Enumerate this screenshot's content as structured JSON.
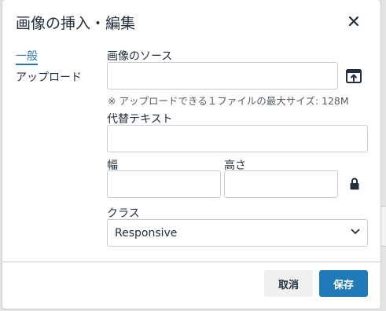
{
  "dialog": {
    "title": "画像の挿入・編集",
    "close_icon": "close-icon"
  },
  "tabs": [
    {
      "label": "一般",
      "active": true
    },
    {
      "label": "アップロード",
      "active": false
    }
  ],
  "form": {
    "source": {
      "label": "画像のソース",
      "value": "",
      "browse_icon": "browse-icon"
    },
    "upload_note": "※ アップロードできる１ファイルの最大サイズ: 128M",
    "alt": {
      "label": "代替テキスト",
      "value": ""
    },
    "width": {
      "label": "幅",
      "value": ""
    },
    "height": {
      "label": "高さ",
      "value": ""
    },
    "lock_icon": "lock-icon",
    "class": {
      "label": "クラス",
      "selected": "Responsive",
      "chevron_icon": "chevron-down-icon"
    }
  },
  "footer": {
    "cancel_label": "取消",
    "save_label": "保存"
  },
  "colors": {
    "accent": "#207ab7",
    "text": "#222f3e"
  }
}
